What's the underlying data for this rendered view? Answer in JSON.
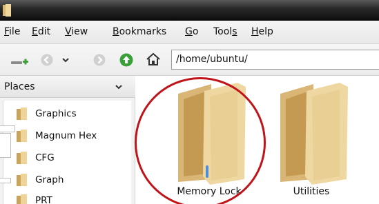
{
  "menu": {
    "file": "File",
    "edit": "Edit",
    "view": "View",
    "bookmarks": "Bookmarks",
    "go": "Go",
    "tools": "Tools",
    "help": "Help"
  },
  "toolbar": {
    "location_path": "/home/ubuntu/"
  },
  "sidebar": {
    "header": "Places",
    "items": [
      {
        "label": "Graphics"
      },
      {
        "label": "Magnum Hex"
      },
      {
        "label": "CFG"
      },
      {
        "label": "Graph"
      },
      {
        "label": "PRT"
      }
    ]
  },
  "files": [
    {
      "name": "Memory Lock",
      "icon": "folder-icon",
      "circled": true
    },
    {
      "name": "Utilities",
      "icon": "folder-icon",
      "circled": false
    }
  ],
  "colors": {
    "highlight_circle": "#c0141b",
    "folder": "#e9cf95",
    "title_bar": "#0c0c0c"
  }
}
